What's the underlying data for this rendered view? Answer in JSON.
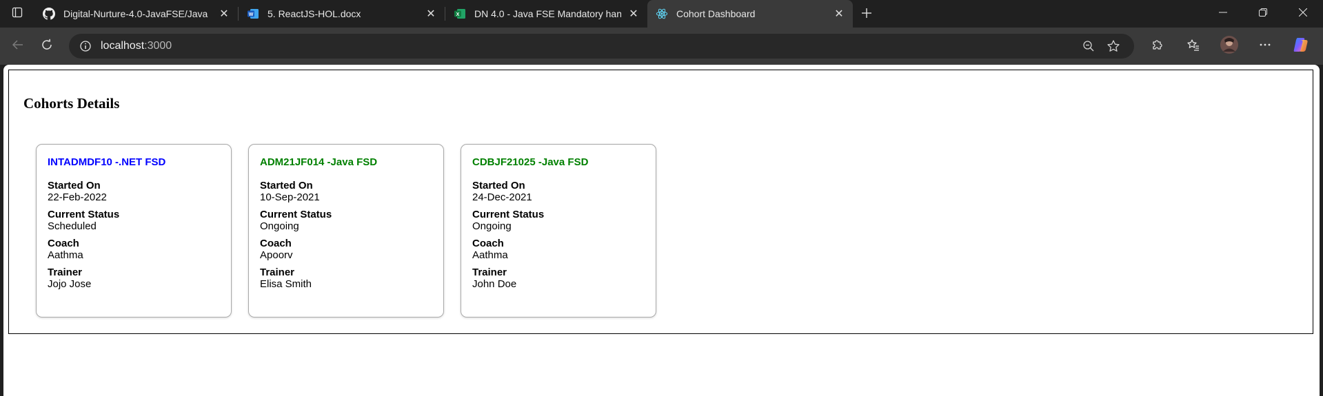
{
  "browser": {
    "tabs": [
      {
        "title": "Digital-Nurture-4.0-JavaFSE/Java",
        "icon": "github-icon",
        "active": false
      },
      {
        "title": "5. ReactJS-HOL.docx",
        "icon": "word-icon",
        "active": false
      },
      {
        "title": "DN 4.0 - Java FSE Mandatory han",
        "icon": "excel-icon",
        "active": false
      },
      {
        "title": "Cohort Dashboard",
        "icon": "react-icon",
        "active": true
      }
    ],
    "address": {
      "host": "localhost",
      "port": ":3000"
    }
  },
  "page": {
    "title": "Cohorts Details",
    "cohorts": [
      {
        "name": "INTADMDF10 -.NET FSD",
        "name_color": "#0000ff",
        "started_label": "Started On",
        "started": "22-Feb-2022",
        "status_label": "Current Status",
        "status": "Scheduled",
        "coach_label": "Coach",
        "coach": "Aathma",
        "trainer_label": "Trainer",
        "trainer": "Jojo Jose"
      },
      {
        "name": "ADM21JF014 -Java FSD",
        "name_color": "#008000",
        "started_label": "Started On",
        "started": "10-Sep-2021",
        "status_label": "Current Status",
        "status": "Ongoing",
        "coach_label": "Coach",
        "coach": "Apoorv",
        "trainer_label": "Trainer",
        "trainer": "Elisa Smith"
      },
      {
        "name": "CDBJF21025 -Java FSD",
        "name_color": "#008000",
        "started_label": "Started On",
        "started": "24-Dec-2021",
        "status_label": "Current Status",
        "status": "Ongoing",
        "coach_label": "Coach",
        "coach": "Aathma",
        "trainer_label": "Trainer",
        "trainer": "John Doe"
      }
    ]
  }
}
